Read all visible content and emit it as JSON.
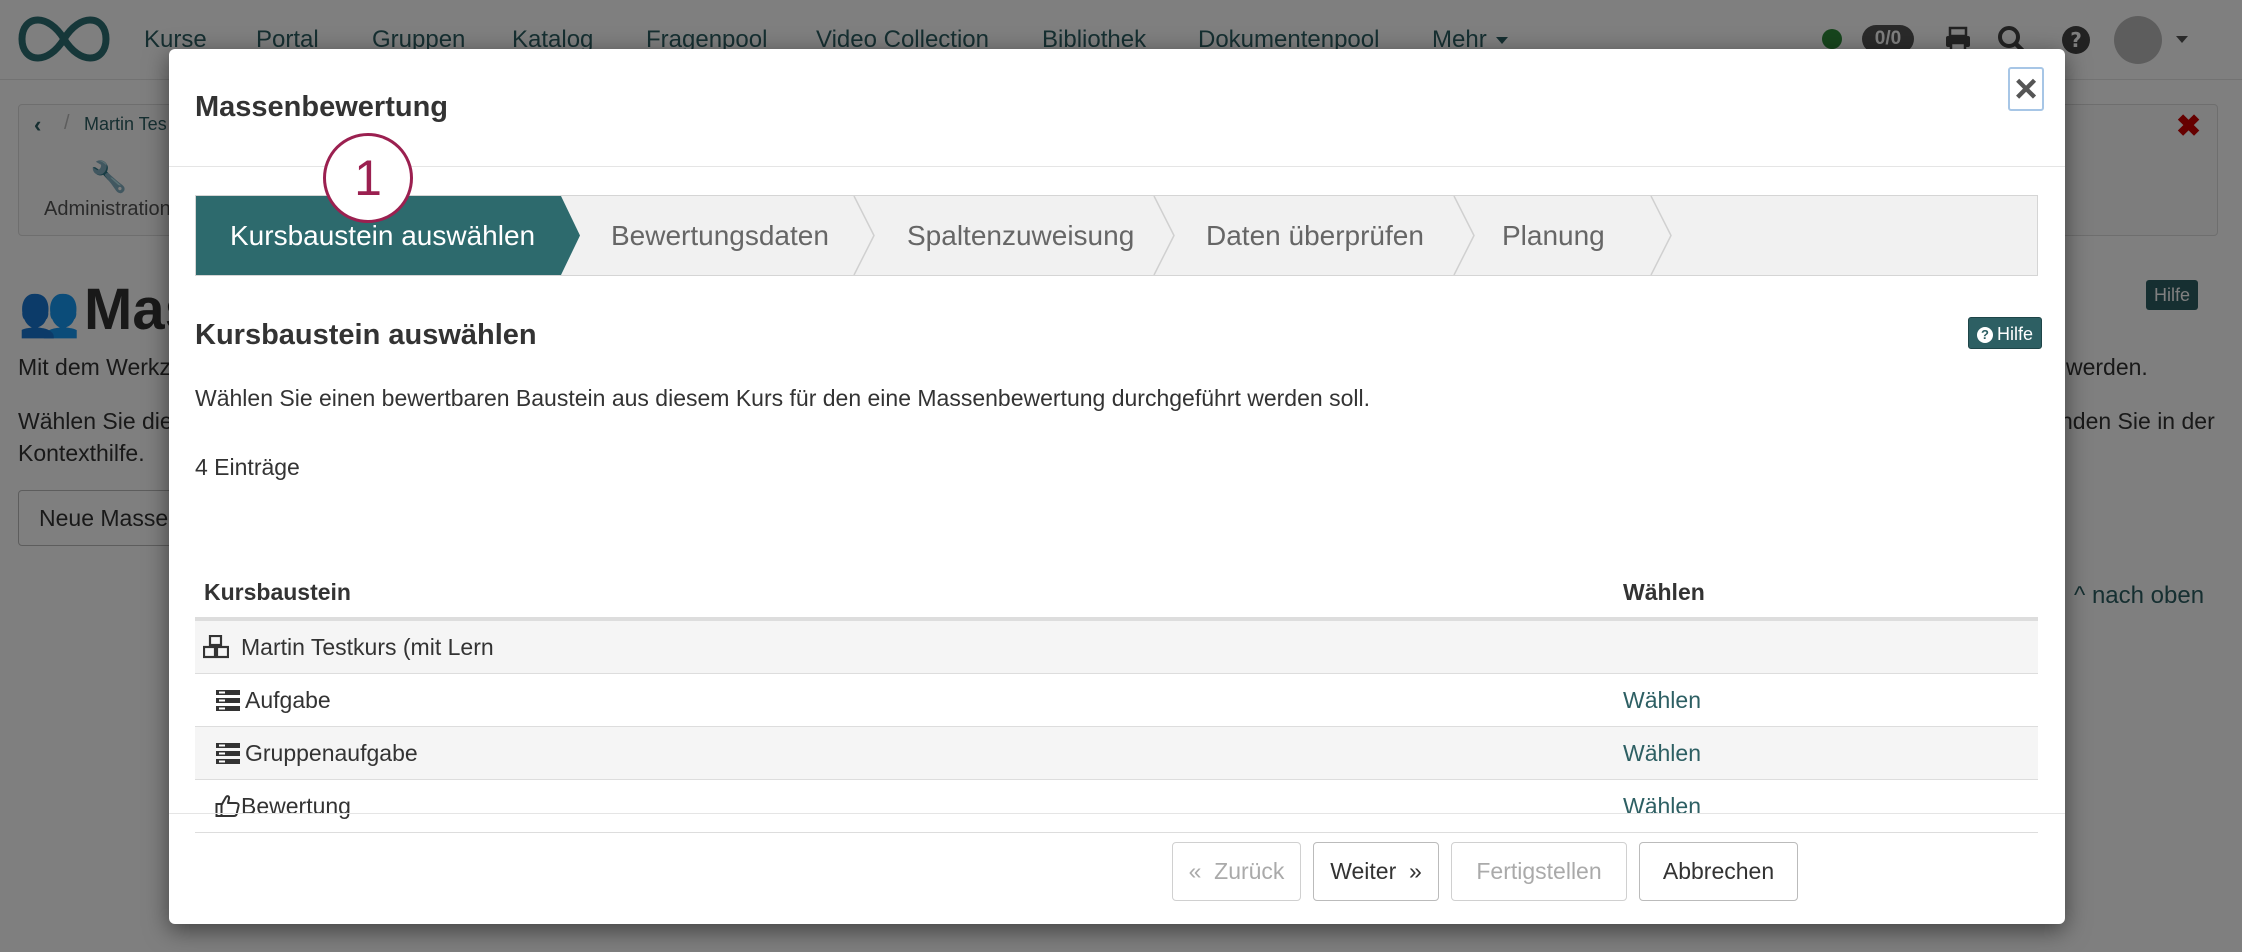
{
  "navbar": {
    "items": [
      "Kurse",
      "Portal",
      "Gruppen",
      "Katalog",
      "Fragenpool",
      "Video Collection",
      "Bibliothek",
      "Dokumentenpool",
      "Mehr"
    ],
    "notification_count": "0/0",
    "icons": [
      "print-icon",
      "search-icon",
      "help-icon",
      "avatar",
      "caret-down-icon"
    ]
  },
  "toolbar": {
    "breadcrumb": "Martin Tes",
    "admin_label": "Administration"
  },
  "background": {
    "title": "Mas",
    "help_label": "Hilfe",
    "line1_left": "Mit dem Werkz",
    "line1_right": "werden.",
    "line2_left": "Wählen Sie die",
    "line2_right": "nden Sie in der",
    "line3_left": "Kontexthilfe.",
    "button": "Neue Masse",
    "top_link": "nach oben"
  },
  "modal": {
    "title": "Massenbewertung",
    "close_symbol": "×",
    "steps": [
      {
        "label": "Kursbaustein auswählen",
        "active": true
      },
      {
        "label": "Bewertungsdaten",
        "active": false
      },
      {
        "label": "Spaltenzuweisung",
        "active": false
      },
      {
        "label": "Daten überprüfen",
        "active": false
      },
      {
        "label": "Planung",
        "active": false
      }
    ],
    "callout_number": "1",
    "section_title": "Kursbaustein auswählen",
    "help_label": "Hilfe",
    "description": "Wählen Sie einen bewertbaren Baustein aus diesem Kurs für den eine Massenbewertung durchgeführt werden soll.",
    "entries_count": "4 Einträge",
    "table": {
      "columns": [
        "Kursbaustein",
        "Wählen"
      ],
      "rows": [
        {
          "icon": "course-icon",
          "label": "Martin Testkurs (mit Lern",
          "action": ""
        },
        {
          "icon": "task-icon",
          "label": "Aufgabe",
          "action": "Wählen"
        },
        {
          "icon": "task-icon",
          "label": "Gruppenaufgabe",
          "action": "Wählen"
        },
        {
          "icon": "thumbs-up-icon",
          "label": "Bewertung",
          "action": "Wählen"
        }
      ]
    },
    "footer": {
      "back": "Zurück",
      "next": "Weiter",
      "finish": "Fertigstellen",
      "cancel": "Abbrechen"
    }
  },
  "colors": {
    "accent": "#2d5f63",
    "callout": "#9b2050",
    "danger": "#cc0000"
  }
}
